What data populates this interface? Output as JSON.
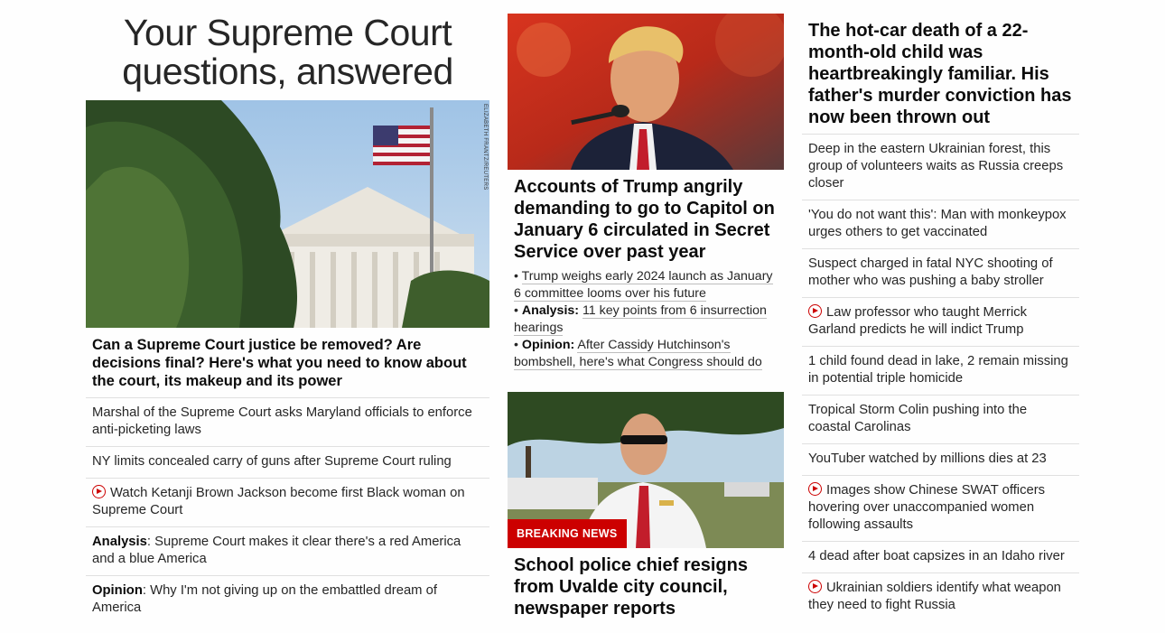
{
  "col1": {
    "title_line1": "Your Supreme Court",
    "title_line2": "questions, answered",
    "photo_credit": "ELIZABETH FRANTZ/REUTERS",
    "headline": "Can a Supreme Court justice be removed? Are decisions final? Here's what you need to know about the court, its makeup and its power",
    "items": [
      {
        "prefix": "",
        "text": "Marshal of the Supreme Court asks Maryland officials to enforce anti-picketing laws"
      },
      {
        "prefix": "",
        "text": "NY limits concealed carry of guns after Supreme Court ruling"
      },
      {
        "prefix": "",
        "text": "Watch Ketanji Brown Jackson become first Black woman on Supreme Court"
      },
      {
        "prefix": "Analysis",
        "text": ": Supreme Court makes it clear there's a red America and a blue America"
      },
      {
        "prefix": "Opinion",
        "text": ": Why I'm not giving up on the embattled dream of America"
      }
    ]
  },
  "col2": {
    "headline": "Accounts of Trump angrily demanding to go to Capitol on January 6 circulated in Secret Service over past year",
    "bullets": [
      {
        "prefix": "",
        "text": "Trump weighs early 2024 launch as January 6 committee looms over his future"
      },
      {
        "prefix": "Analysis:",
        "text": "11 key points from 6 insurrection hearings"
      },
      {
        "prefix": "Opinion:",
        "text": "After Cassidy Hutchinson's bombshell, here's what Congress should do"
      }
    ],
    "breaking_label": "BREAKING NEWS",
    "headline2": "School police chief resigns from Uvalde city council, newspaper reports"
  },
  "col3": {
    "headline": "The hot-car death of a 22-month-old child was heartbreakingly familiar. His father's murder conviction has now been thrown out",
    "items": [
      {
        "text": "Deep in the eastern Ukrainian forest, this group of volunteers waits as Russia creeps closer"
      },
      {
        "text": "'You do not want this': Man with monkeypox urges others to get vaccinated"
      },
      {
        "text": "Suspect charged in fatal NYC shooting of mother who was pushing a baby stroller"
      },
      {
        "text": "Law professor who taught Merrick Garland predicts he will indict Trump"
      },
      {
        "text": "1 child found dead in lake, 2 remain missing in potential triple homicide"
      },
      {
        "text": "Tropical Storm Colin pushing into the coastal Carolinas"
      },
      {
        "text": "YouTuber watched by millions dies at 23"
      },
      {
        "text": "Images show Chinese SWAT officers hovering over unaccompanied women following assaults"
      },
      {
        "text": "4 dead after boat capsizes in an Idaho river"
      },
      {
        "text": "Ukrainian soldiers identify what weapon they need to fight Russia"
      }
    ]
  },
  "colors": {
    "accent": "#cc0000",
    "divider": "#e0e0e0",
    "text": "#262626"
  },
  "icons": {
    "video": "play-circle-icon"
  }
}
